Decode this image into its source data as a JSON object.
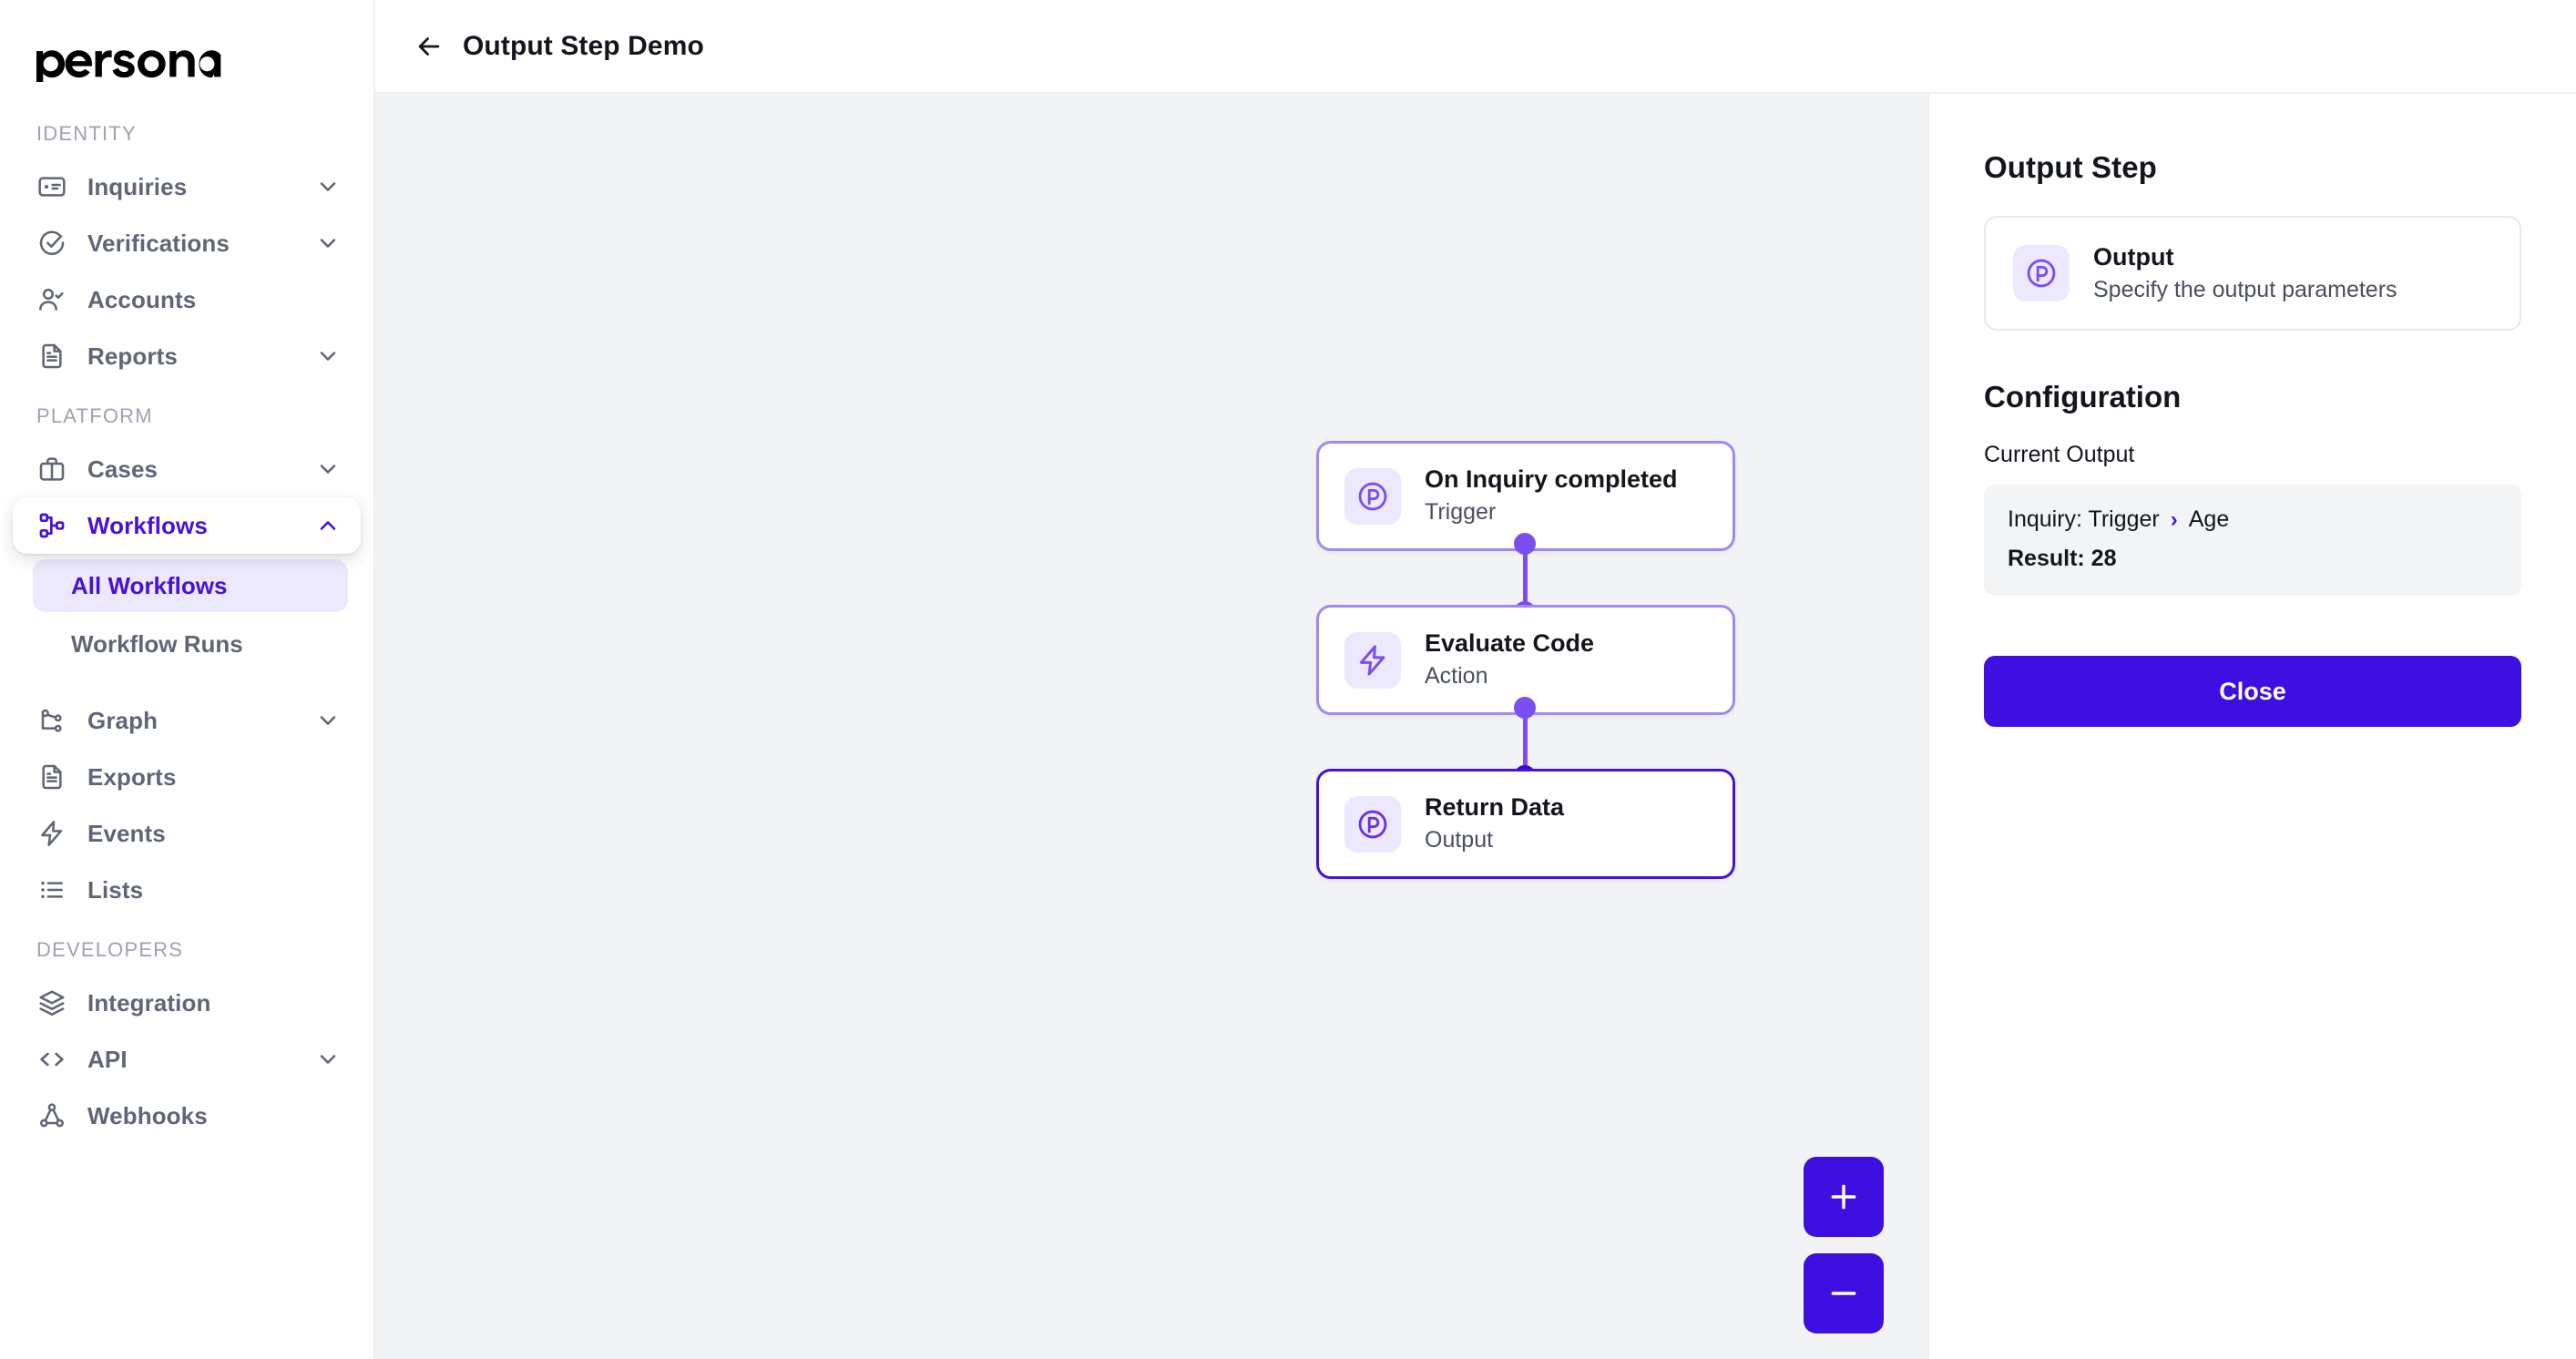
{
  "brand": {
    "name": "persona",
    "accent": "#4711db",
    "accent_strong": "#3d0fe0",
    "node_border": "#a487f2"
  },
  "sidebar": {
    "sections": [
      {
        "label": "IDENTITY",
        "items": [
          {
            "label": "Inquiries",
            "icon": "id-card-icon",
            "chevron": "chevron-down-icon"
          },
          {
            "label": "Verifications",
            "icon": "check-circle-icon",
            "chevron": "chevron-down-icon"
          },
          {
            "label": "Accounts",
            "icon": "user-check-icon",
            "chevron": ""
          },
          {
            "label": "Reports",
            "icon": "document-icon",
            "chevron": "chevron-down-icon"
          }
        ]
      },
      {
        "label": "PLATFORM",
        "items": [
          {
            "label": "Cases",
            "icon": "briefcase-icon",
            "chevron": "chevron-down-icon"
          },
          {
            "label": "Workflows",
            "icon": "workflow-icon",
            "chevron": "chevron-up-icon",
            "active": true,
            "children": [
              {
                "label": "All Workflows",
                "selected": true
              },
              {
                "label": "Workflow Runs",
                "selected": false
              }
            ]
          },
          {
            "label": "Graph",
            "icon": "graph-icon",
            "chevron": "chevron-down-icon"
          },
          {
            "label": "Exports",
            "icon": "document-icon",
            "chevron": ""
          },
          {
            "label": "Events",
            "icon": "bolt-icon",
            "chevron": ""
          },
          {
            "label": "Lists",
            "icon": "list-icon",
            "chevron": ""
          }
        ]
      },
      {
        "label": "DEVELOPERS",
        "items": [
          {
            "label": "Integration",
            "icon": "layers-icon",
            "chevron": ""
          },
          {
            "label": "API",
            "icon": "code-icon",
            "chevron": "chevron-down-icon"
          },
          {
            "label": "Webhooks",
            "icon": "webhook-icon",
            "chevron": ""
          }
        ]
      }
    ]
  },
  "topbar": {
    "back_icon": "arrow-left-icon",
    "title": "Output Step Demo"
  },
  "canvas": {
    "nodes": [
      {
        "title": "On Inquiry completed",
        "subtitle": "Trigger",
        "icon": "persona-mark-icon",
        "selected": false
      },
      {
        "title": "Evaluate Code",
        "subtitle": "Action",
        "icon": "bolt-icon",
        "selected": false
      },
      {
        "title": "Return Data",
        "subtitle": "Output",
        "icon": "persona-mark-icon",
        "selected": true
      }
    ],
    "zoom_in_label": "+",
    "zoom_out_label": "–"
  },
  "right_panel": {
    "heading": "Output Step",
    "step_card": {
      "icon": "persona-mark-icon",
      "title": "Output",
      "subtitle": "Specify the output parameters"
    },
    "configuration_heading": "Configuration",
    "current_output_label": "Current Output",
    "output_value": {
      "source": "Inquiry: Trigger",
      "separator": "›",
      "field": "Age",
      "result": "Result: 28"
    },
    "close_label": "Close"
  }
}
